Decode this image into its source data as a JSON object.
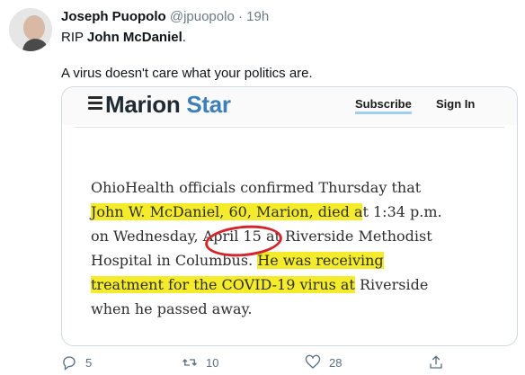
{
  "tweet": {
    "author_name": "Joseph Puopolo",
    "author_handle": "@jpuopolo",
    "separator": "·",
    "time": "19h",
    "text_prefix": "RIP ",
    "text_bold": "John McDaniel",
    "text_suffix": ".",
    "text_line2": "A virus doesn't care what your politics are."
  },
  "media": {
    "logo_part1": "Marion",
    "logo_part2": "Star",
    "subscribe_label": "Subscribe",
    "signin_label": "Sign In",
    "article": {
      "l1": "OhioHealth officials confirmed Thursday that",
      "l2a": "John W. McDaniel, 60, Marion, died a",
      "l2b": "t 1:34 p.m.",
      "l3a": "on Wednesday, ",
      "l3b": "April 15",
      "l3c": " at Riverside Methodist",
      "l4a": "Hospital in Columbus. ",
      "l4b": "He was receiving",
      "l5a": "treatment for the COVID-19 virus at",
      "l5b": " Riverside",
      "l6": "when he passed away."
    },
    "highlight_color": "#f4ec2a",
    "circle_color": "#d2262c"
  },
  "actions": {
    "reply_count": "5",
    "retweet_count": "10",
    "like_count": "28"
  }
}
